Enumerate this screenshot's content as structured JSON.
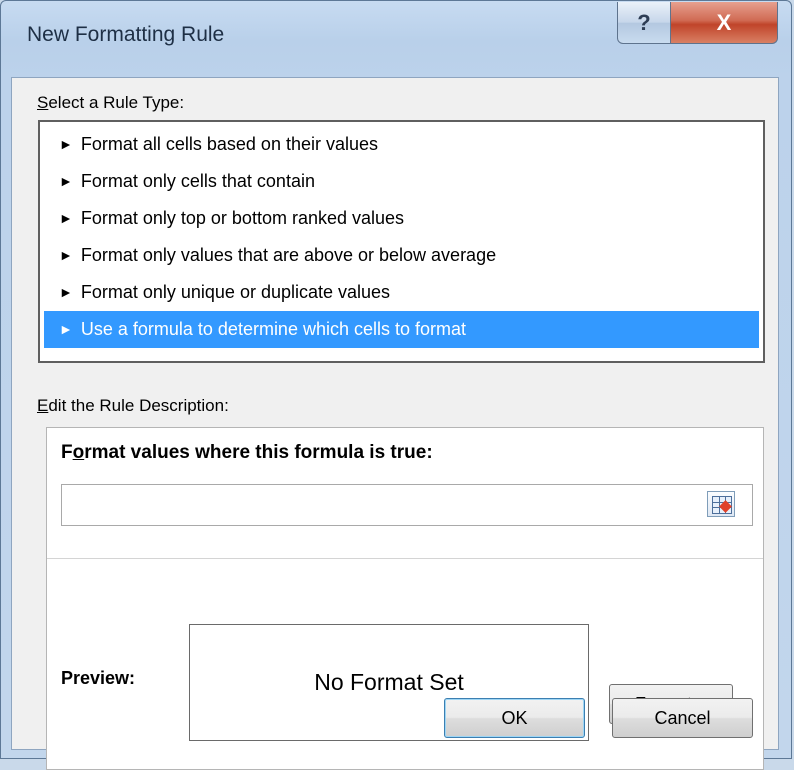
{
  "window": {
    "title": "New Formatting Rule",
    "help_glyph": "?",
    "close_glyph": "X"
  },
  "rule_type": {
    "label_access_key": "S",
    "label_rest": "elect a Rule Type:",
    "items": [
      {
        "label": "Format all cells based on their values",
        "selected": false
      },
      {
        "label": "Format only cells that contain",
        "selected": false
      },
      {
        "label": "Format only top or bottom ranked values",
        "selected": false
      },
      {
        "label": "Format only values that are above or below average",
        "selected": false
      },
      {
        "label": "Format only unique or duplicate values",
        "selected": false
      },
      {
        "label": "Use a formula to determine which cells to format",
        "selected": true
      }
    ],
    "arrow_glyph": "►"
  },
  "description": {
    "label_access_key": "E",
    "label_rest": "dit the Rule Description:",
    "heading_prefix": "F",
    "heading_access_key": "o",
    "heading_rest": "rmat values where this formula is true:",
    "formula_value": "",
    "preview_label": "Preview:",
    "preview_text": "No Format Set",
    "format_button_access_key": "F",
    "format_button_rest": "ormat..."
  },
  "buttons": {
    "ok_label": "OK",
    "cancel_label": "Cancel"
  },
  "colors": {
    "selection": "#3399ff",
    "close_button": "#c7452c"
  }
}
